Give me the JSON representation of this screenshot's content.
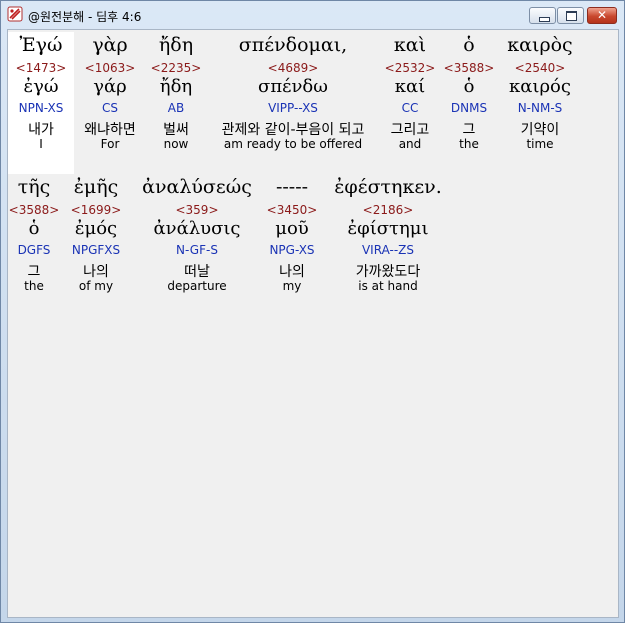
{
  "window": {
    "title": "@원전분해 - 딤후 4:6",
    "buttons": {
      "minimize": "minimize",
      "maximize": "maximize",
      "close": "✕"
    }
  },
  "row1": [
    {
      "greek": "Ἐγώ",
      "number": "<1473>",
      "lemma": "ἐγώ",
      "parse": "NPN-XS",
      "korean": "내가",
      "english": "I"
    },
    {
      "greek": "γὰρ",
      "number": "<1063>",
      "lemma": "γάρ",
      "parse": "CS",
      "korean": "왜냐하면",
      "english": "For"
    },
    {
      "greek": "ἤδη",
      "number": "<2235>",
      "lemma": "ἤδη",
      "parse": "AB",
      "korean": "벌써",
      "english": "now"
    },
    {
      "greek": "σπένδομαι,",
      "number": "<4689>",
      "lemma": "σπένδω",
      "parse": "VIPP--XS",
      "korean": "관제와 같이-부음이 되고",
      "english": "am ready to be offered"
    },
    {
      "greek": "καὶ",
      "number": "<2532>",
      "lemma": "καί",
      "parse": "CC",
      "korean": "그리고",
      "english": "and"
    },
    {
      "greek": "ὁ",
      "number": "<3588>",
      "lemma": "ὁ",
      "parse": "DNMS",
      "korean": "그",
      "english": "the"
    },
    {
      "greek": "καιρὸς",
      "number": "<2540>",
      "lemma": "καιρός",
      "parse": "N-NM-S",
      "korean": "기약이",
      "english": "time"
    }
  ],
  "row2": [
    {
      "greek": "τῆς",
      "number": "<3588>",
      "lemma": "ὁ",
      "parse": "DGFS",
      "korean": "그",
      "english": "the"
    },
    {
      "greek": "ἐμῆς",
      "number": "<1699>",
      "lemma": "ἐμός",
      "parse": "NPGFXS",
      "korean": "나의",
      "english": "of my"
    },
    {
      "greek": "ἀναλύσεώς",
      "number": "<359>",
      "lemma": "ἀνάλυσις",
      "parse": "N-GF-S",
      "korean": "떠날",
      "english": "departure"
    },
    {
      "greek": "-----",
      "number": "<3450>",
      "lemma": "μοῦ",
      "parse": "NPG-XS",
      "korean": "나의",
      "english": "my"
    },
    {
      "greek": "ἐφέστηκεν.",
      "number": "<2186>",
      "lemma": "ἐφίστημι",
      "parse": "VIRA--ZS",
      "korean": "가까왔도다",
      "english": "is at hand"
    }
  ]
}
